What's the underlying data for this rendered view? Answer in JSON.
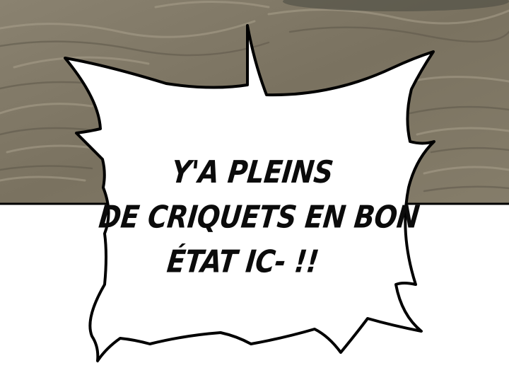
{
  "speech_bubble": {
    "lines": [
      "Y'A PLEINS",
      "DE CRIQUETS EN BON",
      "ÉTAT IC- !!"
    ]
  },
  "colors": {
    "ground_base": "#7d7563",
    "ground_light": "#a39a86",
    "ground_dark": "#5a5447",
    "panel_border": "#000000",
    "bubble_fill": "#ffffff",
    "text": "#0b0b0b"
  }
}
